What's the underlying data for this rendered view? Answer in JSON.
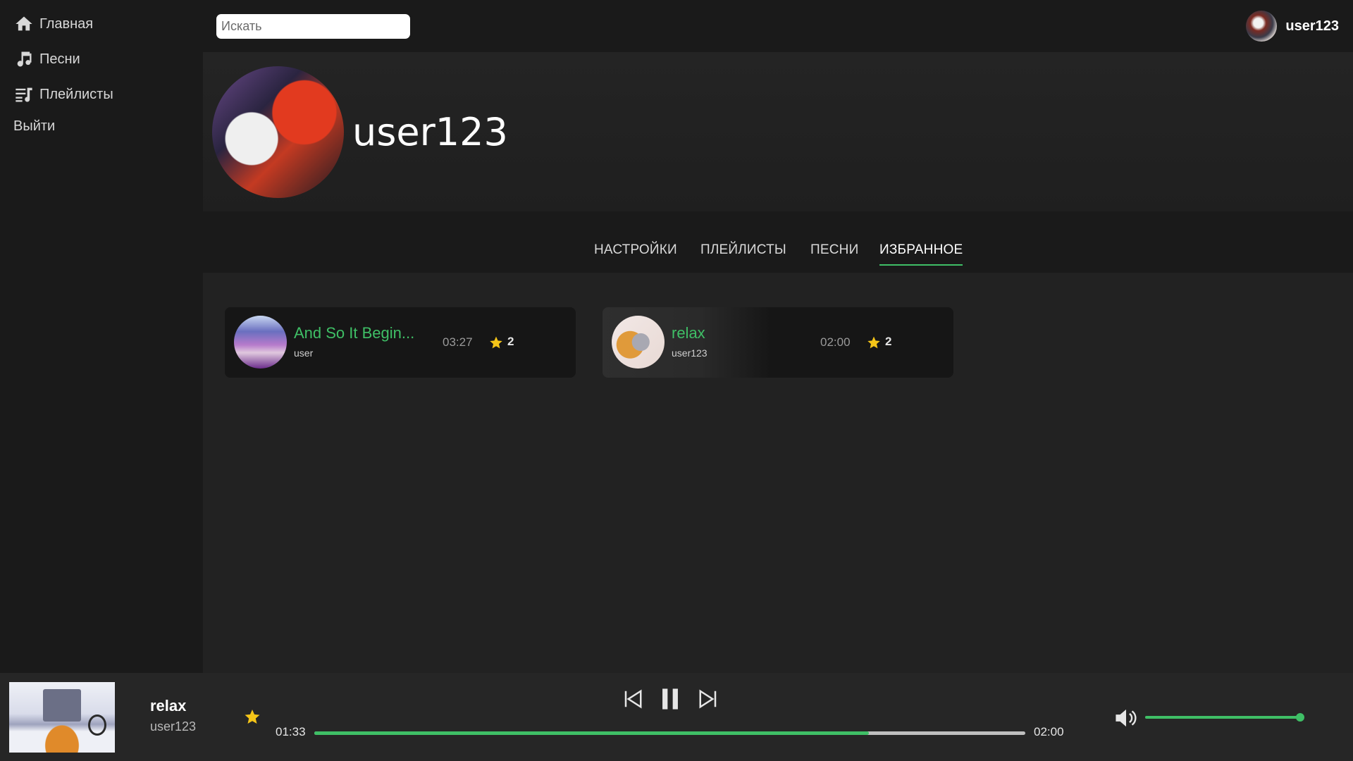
{
  "sidebar": {
    "items": [
      {
        "label": "Главная",
        "icon": "home-icon"
      },
      {
        "label": "Песни",
        "icon": "music-note-icon"
      },
      {
        "label": "Плейлисты",
        "icon": "playlist-icon"
      },
      {
        "label": "Выйти"
      }
    ]
  },
  "topbar": {
    "search_placeholder": "Искать",
    "username": "user123"
  },
  "profile": {
    "name": "user123"
  },
  "tabs": [
    {
      "label": "НАСТРОЙКИ"
    },
    {
      "label": "ПЛЕЙЛИСТЫ"
    },
    {
      "label": "ПЕСНИ"
    },
    {
      "label": "ИЗБРАННОЕ",
      "active": true
    }
  ],
  "favorites": [
    {
      "title": "And So It Begin...",
      "artist": "user",
      "duration": "03:27",
      "rating": "2"
    },
    {
      "title": "relax",
      "artist": "user123",
      "duration": "02:00",
      "rating": "2"
    }
  ],
  "player": {
    "title": "relax",
    "artist": "user123",
    "current_time": "01:33",
    "total_time": "02:00",
    "progress": 0.78,
    "volume": 1.0
  },
  "colors": {
    "accent": "#3fbf66",
    "star": "#f5c518",
    "background": "#222222",
    "panel": "#1a1a1a"
  }
}
